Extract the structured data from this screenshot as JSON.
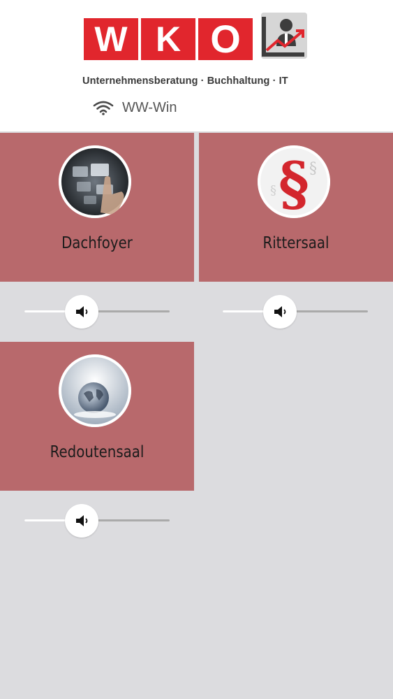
{
  "header": {
    "logo_letters": [
      "W",
      "K",
      "O"
    ],
    "tagline": "Unternehmensberatung · Buchhaltung · IT",
    "network": {
      "icon": "wifi-icon",
      "name": "WW-Win"
    }
  },
  "rooms": [
    {
      "name": "Dachfoyer",
      "image": "touchscreen-hand-image",
      "volume": 0.3
    },
    {
      "name": "Rittersaal",
      "image": "paragraph-symbol-image",
      "volume": 0.3
    },
    {
      "name": "Redoutensaal",
      "image": "globe-image",
      "volume": 0.3
    }
  ],
  "colors": {
    "tile": "#b8696c",
    "background": "#dcdcdf",
    "logo_red": "#e1262d"
  }
}
